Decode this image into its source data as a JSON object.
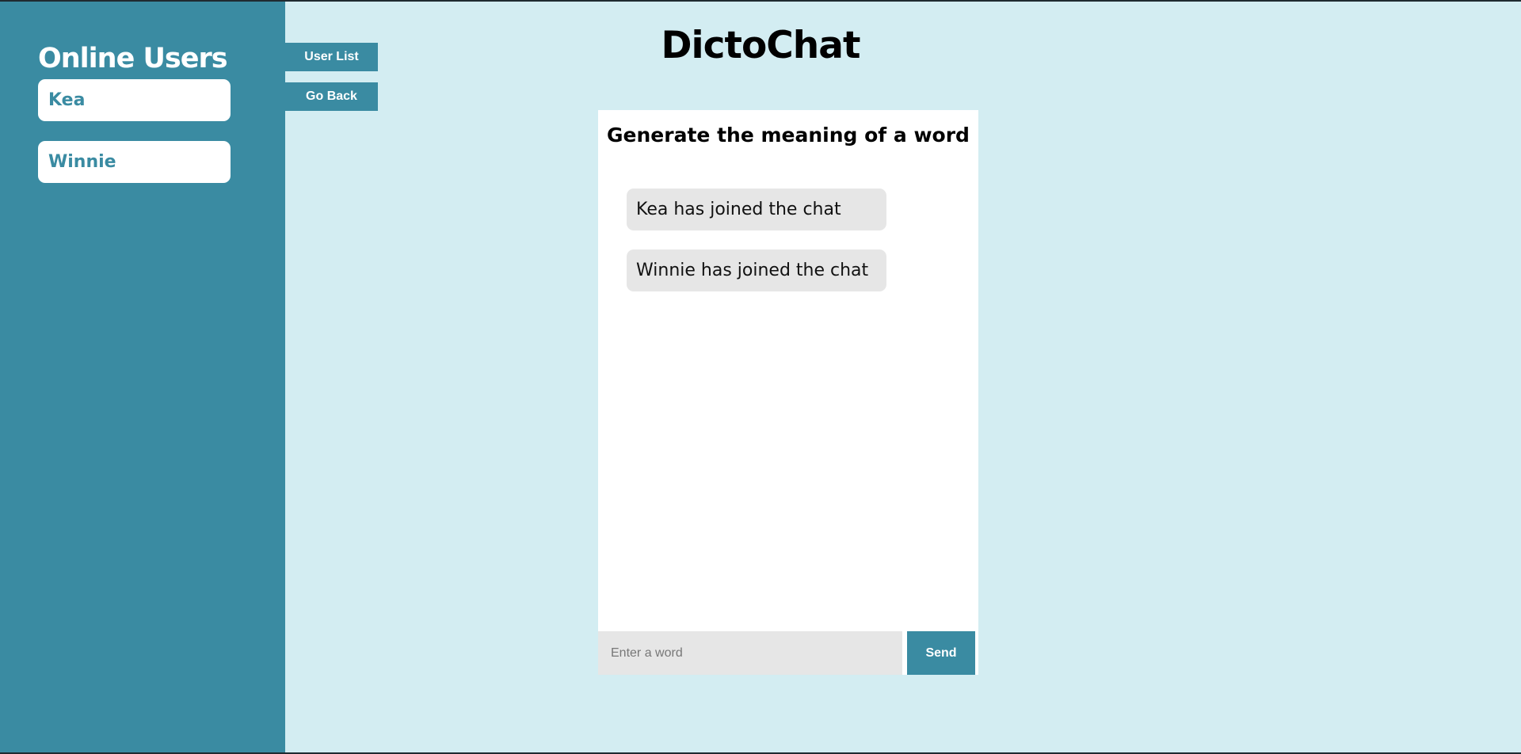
{
  "sidebar": {
    "title": "Online Users",
    "users": [
      {
        "name": "Kea"
      },
      {
        "name": "Winnie"
      }
    ]
  },
  "nav": {
    "user_list_label": "User List",
    "go_back_label": "Go Back"
  },
  "header": {
    "title": "DictoChat"
  },
  "chat": {
    "heading": "Generate the meaning of a word",
    "messages": [
      {
        "text": "Kea has joined the chat"
      },
      {
        "text": "Winnie has joined the chat"
      }
    ],
    "input": {
      "value": "",
      "placeholder": "Enter a word"
    },
    "send_label": "Send"
  },
  "colors": {
    "background": "#d3edf2",
    "accent": "#3a8ba2",
    "panel": "#ffffff",
    "message_bubble": "#e6e6e6"
  }
}
